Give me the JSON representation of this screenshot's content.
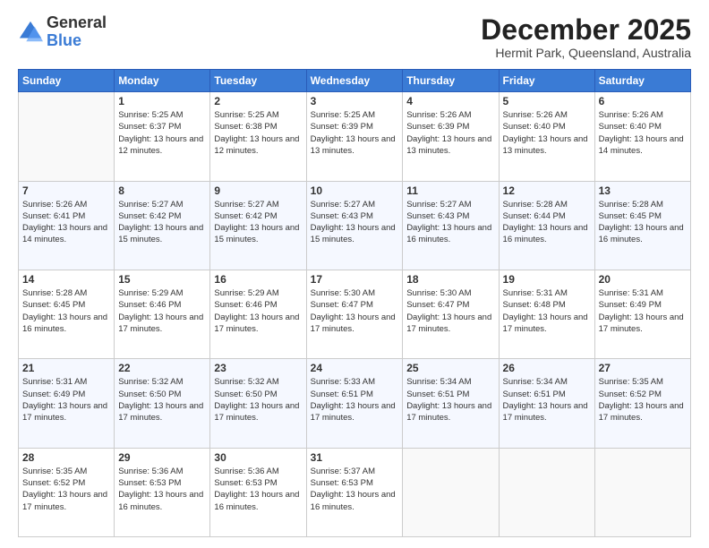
{
  "logo": {
    "general": "General",
    "blue": "Blue"
  },
  "header": {
    "month": "December 2025",
    "location": "Hermit Park, Queensland, Australia"
  },
  "weekdays": [
    "Sunday",
    "Monday",
    "Tuesday",
    "Wednesday",
    "Thursday",
    "Friday",
    "Saturday"
  ],
  "weeks": [
    [
      {
        "day": "",
        "info": ""
      },
      {
        "day": "1",
        "info": "Sunrise: 5:25 AM\nSunset: 6:37 PM\nDaylight: 13 hours\nand 12 minutes."
      },
      {
        "day": "2",
        "info": "Sunrise: 5:25 AM\nSunset: 6:38 PM\nDaylight: 13 hours\nand 12 minutes."
      },
      {
        "day": "3",
        "info": "Sunrise: 5:25 AM\nSunset: 6:39 PM\nDaylight: 13 hours\nand 13 minutes."
      },
      {
        "day": "4",
        "info": "Sunrise: 5:26 AM\nSunset: 6:39 PM\nDaylight: 13 hours\nand 13 minutes."
      },
      {
        "day": "5",
        "info": "Sunrise: 5:26 AM\nSunset: 6:40 PM\nDaylight: 13 hours\nand 13 minutes."
      },
      {
        "day": "6",
        "info": "Sunrise: 5:26 AM\nSunset: 6:40 PM\nDaylight: 13 hours\nand 14 minutes."
      }
    ],
    [
      {
        "day": "7",
        "info": "Sunrise: 5:26 AM\nSunset: 6:41 PM\nDaylight: 13 hours\nand 14 minutes."
      },
      {
        "day": "8",
        "info": "Sunrise: 5:27 AM\nSunset: 6:42 PM\nDaylight: 13 hours\nand 15 minutes."
      },
      {
        "day": "9",
        "info": "Sunrise: 5:27 AM\nSunset: 6:42 PM\nDaylight: 13 hours\nand 15 minutes."
      },
      {
        "day": "10",
        "info": "Sunrise: 5:27 AM\nSunset: 6:43 PM\nDaylight: 13 hours\nand 15 minutes."
      },
      {
        "day": "11",
        "info": "Sunrise: 5:27 AM\nSunset: 6:43 PM\nDaylight: 13 hours\nand 16 minutes."
      },
      {
        "day": "12",
        "info": "Sunrise: 5:28 AM\nSunset: 6:44 PM\nDaylight: 13 hours\nand 16 minutes."
      },
      {
        "day": "13",
        "info": "Sunrise: 5:28 AM\nSunset: 6:45 PM\nDaylight: 13 hours\nand 16 minutes."
      }
    ],
    [
      {
        "day": "14",
        "info": "Sunrise: 5:28 AM\nSunset: 6:45 PM\nDaylight: 13 hours\nand 16 minutes."
      },
      {
        "day": "15",
        "info": "Sunrise: 5:29 AM\nSunset: 6:46 PM\nDaylight: 13 hours\nand 17 minutes."
      },
      {
        "day": "16",
        "info": "Sunrise: 5:29 AM\nSunset: 6:46 PM\nDaylight: 13 hours\nand 17 minutes."
      },
      {
        "day": "17",
        "info": "Sunrise: 5:30 AM\nSunset: 6:47 PM\nDaylight: 13 hours\nand 17 minutes."
      },
      {
        "day": "18",
        "info": "Sunrise: 5:30 AM\nSunset: 6:47 PM\nDaylight: 13 hours\nand 17 minutes."
      },
      {
        "day": "19",
        "info": "Sunrise: 5:31 AM\nSunset: 6:48 PM\nDaylight: 13 hours\nand 17 minutes."
      },
      {
        "day": "20",
        "info": "Sunrise: 5:31 AM\nSunset: 6:49 PM\nDaylight: 13 hours\nand 17 minutes."
      }
    ],
    [
      {
        "day": "21",
        "info": "Sunrise: 5:31 AM\nSunset: 6:49 PM\nDaylight: 13 hours\nand 17 minutes."
      },
      {
        "day": "22",
        "info": "Sunrise: 5:32 AM\nSunset: 6:50 PM\nDaylight: 13 hours\nand 17 minutes."
      },
      {
        "day": "23",
        "info": "Sunrise: 5:32 AM\nSunset: 6:50 PM\nDaylight: 13 hours\nand 17 minutes."
      },
      {
        "day": "24",
        "info": "Sunrise: 5:33 AM\nSunset: 6:51 PM\nDaylight: 13 hours\nand 17 minutes."
      },
      {
        "day": "25",
        "info": "Sunrise: 5:34 AM\nSunset: 6:51 PM\nDaylight: 13 hours\nand 17 minutes."
      },
      {
        "day": "26",
        "info": "Sunrise: 5:34 AM\nSunset: 6:51 PM\nDaylight: 13 hours\nand 17 minutes."
      },
      {
        "day": "27",
        "info": "Sunrise: 5:35 AM\nSunset: 6:52 PM\nDaylight: 13 hours\nand 17 minutes."
      }
    ],
    [
      {
        "day": "28",
        "info": "Sunrise: 5:35 AM\nSunset: 6:52 PM\nDaylight: 13 hours\nand 17 minutes."
      },
      {
        "day": "29",
        "info": "Sunrise: 5:36 AM\nSunset: 6:53 PM\nDaylight: 13 hours\nand 16 minutes."
      },
      {
        "day": "30",
        "info": "Sunrise: 5:36 AM\nSunset: 6:53 PM\nDaylight: 13 hours\nand 16 minutes."
      },
      {
        "day": "31",
        "info": "Sunrise: 5:37 AM\nSunset: 6:53 PM\nDaylight: 13 hours\nand 16 minutes."
      },
      {
        "day": "",
        "info": ""
      },
      {
        "day": "",
        "info": ""
      },
      {
        "day": "",
        "info": ""
      }
    ]
  ]
}
